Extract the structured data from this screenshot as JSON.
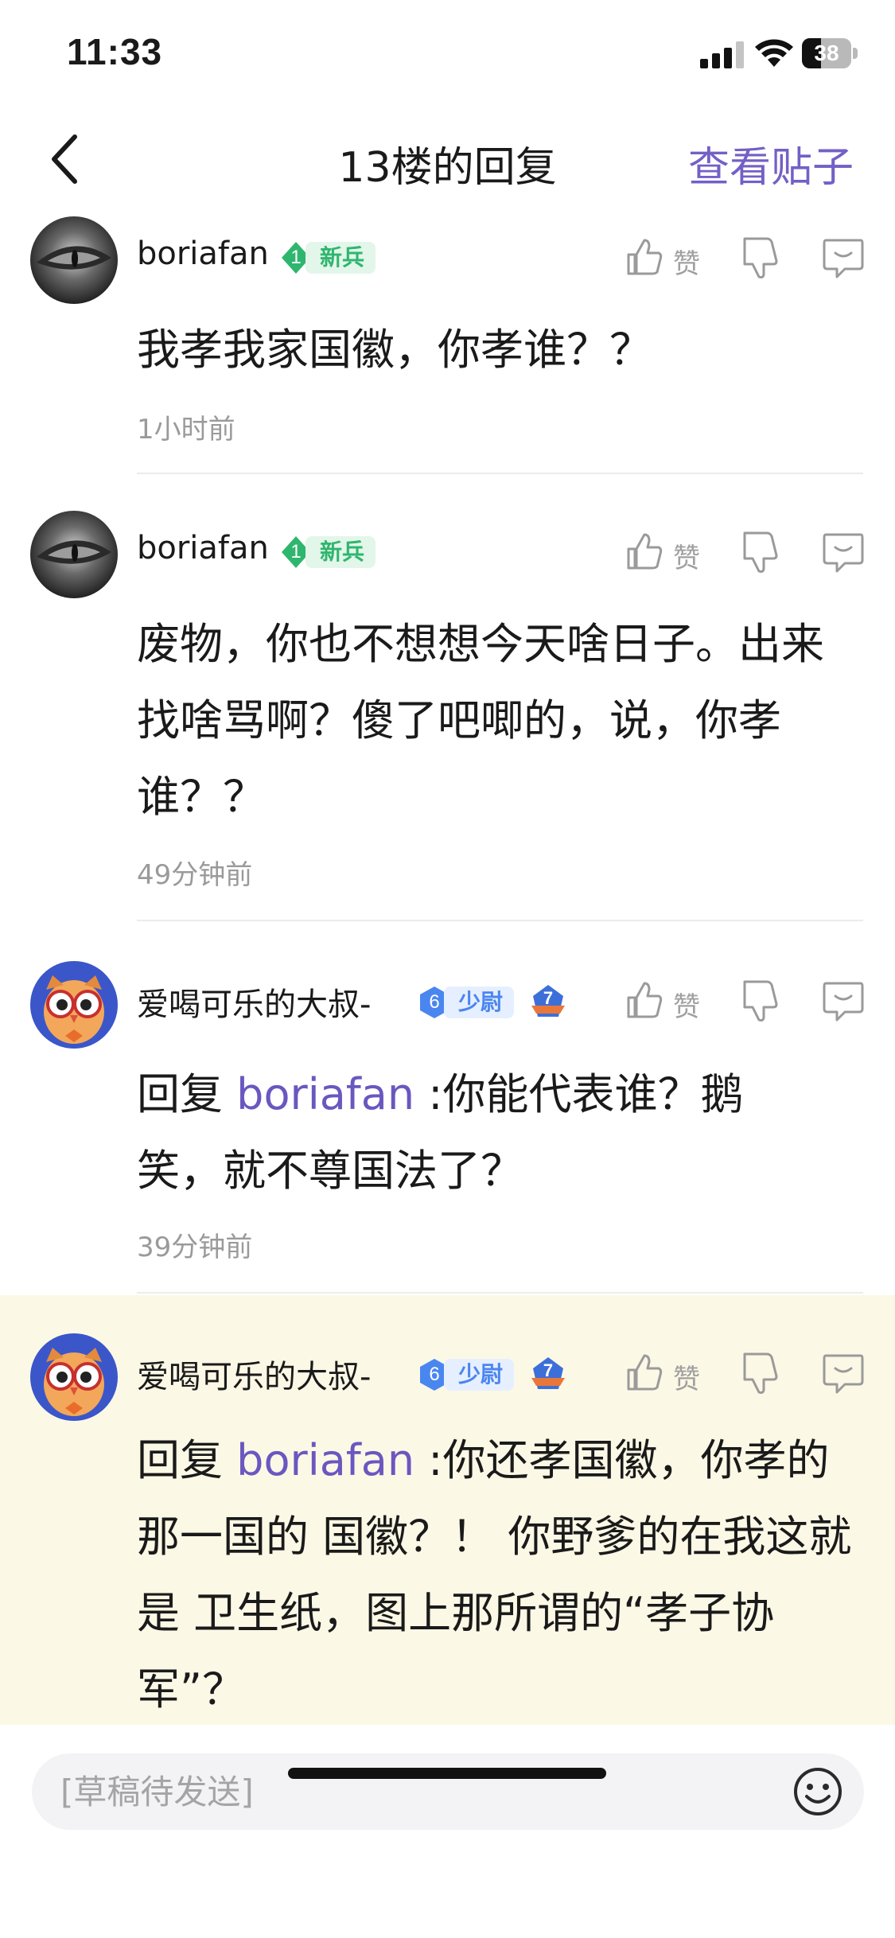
{
  "status_bar": {
    "time": "11:33",
    "battery": "38",
    "battery_level": 0.38
  },
  "nav": {
    "title": "13楼的回复",
    "view_post": "查看贴子"
  },
  "actions": {
    "like": "赞"
  },
  "comments": [
    {
      "username": "boriafan",
      "level": "1",
      "level_title": "新兵",
      "level_color": "#2fb66e",
      "text": "我孝我家国徽，你孝谁？？",
      "time": "1小时前"
    },
    {
      "username": "boriafan",
      "level": "1",
      "level_title": "新兵",
      "level_color": "#2fb66e",
      "text": "废物，你也不想想今天啥日子。出来找啥骂啊？傻了吧唧的，说，你孝谁？？",
      "time": "49分钟前"
    },
    {
      "username": "爱喝可乐的大叔-",
      "level": "6",
      "level_title": "少尉",
      "level_color": "#4a86f0",
      "rank_badge": "7",
      "reply_prefix": "回复 ",
      "reply_to": "boriafan",
      "text": " :你能代表谁？鹅笑，就不尊国法了？",
      "time": "39分钟前"
    },
    {
      "username": "爱喝可乐的大叔-",
      "level": "6",
      "level_title": "少尉",
      "level_color": "#4a86f0",
      "rank_badge": "7",
      "reply_prefix": "回复 ",
      "reply_to": "boriafan",
      "text": " :你还孝国徽，你孝的那一国的 国徽？！ 你野爹的在我这就是 卫生纸，图上那所谓的“孝子协军”？"
    }
  ],
  "composer": {
    "placeholder": "[草稿待发送]"
  },
  "colors": {
    "accent": "#7360c6",
    "mention": "#6a57c0",
    "highlight_bg": "#fcf8e6"
  }
}
